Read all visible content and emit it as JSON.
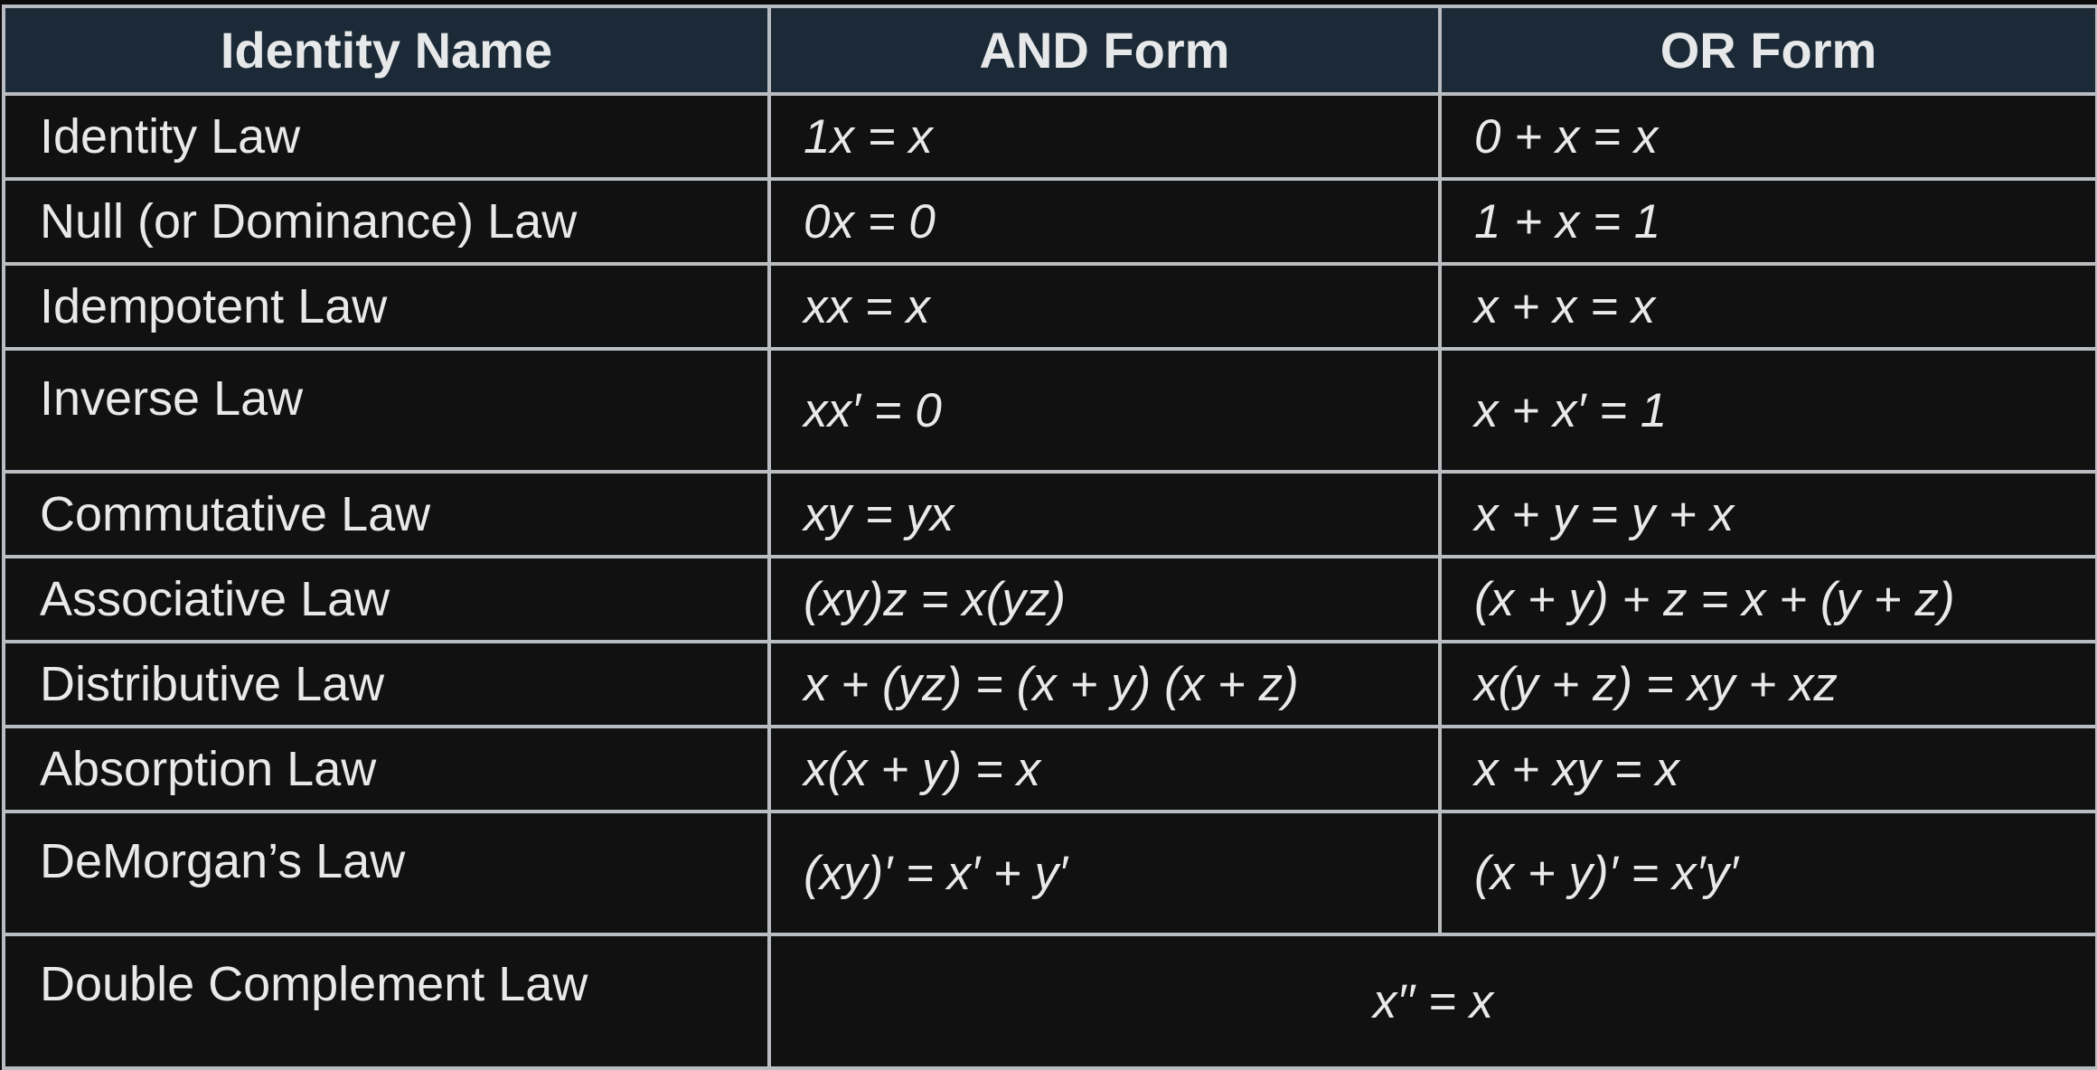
{
  "table": {
    "headers": [
      "Identity Name",
      "AND Form",
      "OR Form"
    ],
    "rows": [
      {
        "name": "Identity Law",
        "and_form": "1x = x",
        "or_form": "0 + x = x"
      },
      {
        "name": "Null (or Dominance) Law",
        "and_form": "0x = 0",
        "or_form": "1 + x = 1"
      },
      {
        "name": "Idempotent Law",
        "and_form": "xx = x",
        "or_form": "x + x = x"
      },
      {
        "name": "Inverse Law",
        "and_form": "xx′ = 0",
        "or_form": "x + x′ = 1"
      },
      {
        "name": "Commutative Law",
        "and_form": "xy = yx",
        "or_form": "x + y = y + x"
      },
      {
        "name": "Associative Law",
        "and_form": "(xy)z = x(yz)",
        "or_form": "(x + y) + z = x + (y + z)"
      },
      {
        "name": "Distributive Law",
        "and_form": "x + (yz) = (x + y) (x + z)",
        "or_form": "x(y + z) = xy + xz"
      },
      {
        "name": "Absorption Law",
        "and_form": "x(x + y) = x",
        "or_form": "x + xy = x"
      },
      {
        "name": "DeMorgan’s Law",
        "and_form": "(xy)′ = x′ + y′",
        "or_form": "(x + y)′ = x′y′"
      }
    ],
    "last_row": {
      "name": "Double Complement Law",
      "formula": "x′′ = x"
    }
  }
}
